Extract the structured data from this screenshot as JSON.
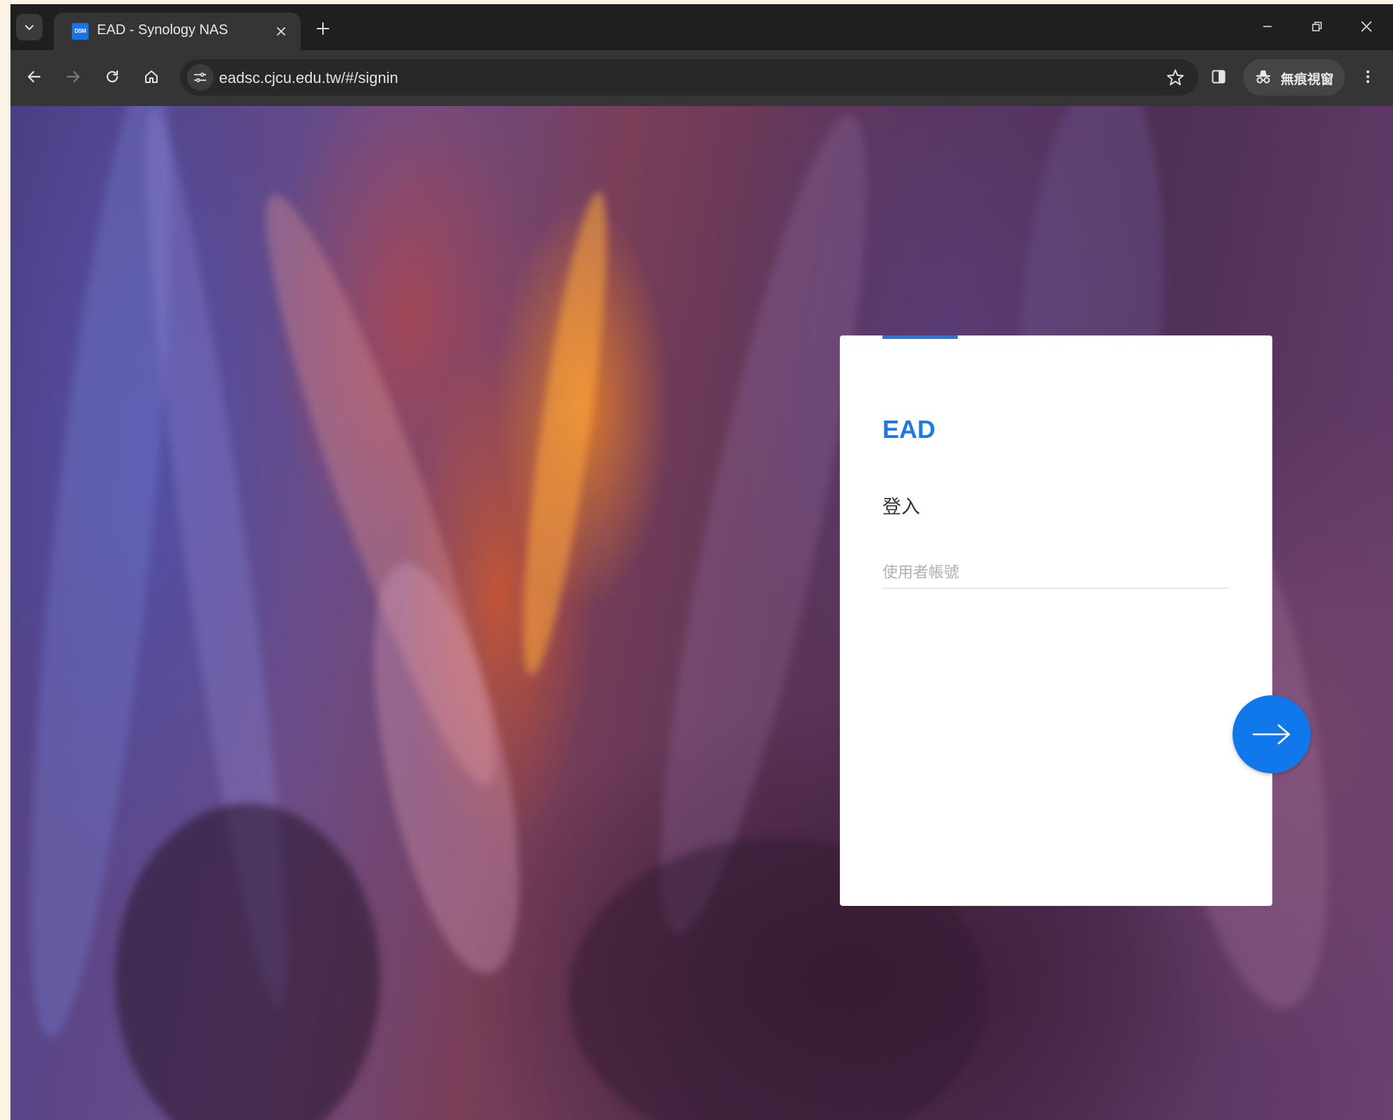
{
  "browser": {
    "tab": {
      "favicon_text": "DSM",
      "title": "EAD - Synology NAS"
    },
    "address_bar": {
      "url": "eadsc.cjcu.edu.tw/#/signin"
    },
    "incognito_label": "無痕視窗"
  },
  "login": {
    "app_name": "EAD",
    "heading": "登入",
    "username_placeholder": "使用者帳號",
    "username_value": ""
  },
  "colors": {
    "accent": "#1e78e6",
    "next_button": "#1078ea"
  }
}
